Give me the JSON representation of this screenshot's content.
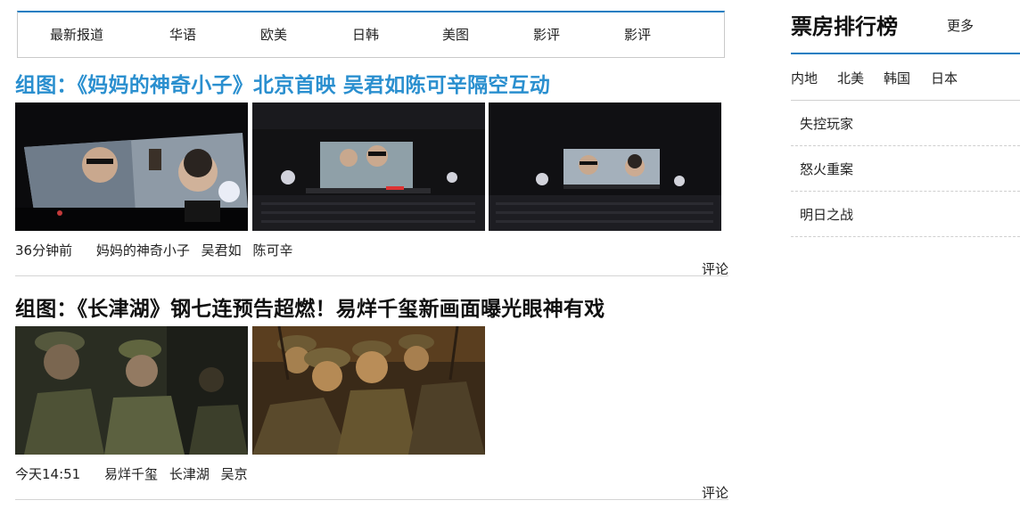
{
  "nav": {
    "tabs": [
      "最新报道",
      "华语",
      "欧美",
      "日韩",
      "美图",
      "影评",
      "影评"
    ],
    "accent_color": "#1b7ec2"
  },
  "articles": [
    {
      "title": "组图：《妈妈的神奇小子》北京首映 吴君如陈可辛隔空互动",
      "title_color": "#2a8fcf",
      "images": [
        "cinema-screen-photo",
        "cinema-hall-photo",
        "cinema-hall-wide-photo"
      ],
      "time": "36分钟前",
      "tags": [
        "妈妈的神奇小子",
        "吴君如",
        "陈可辛"
      ],
      "comment_label": "评论"
    },
    {
      "title": "组图：《长津湖》钢七连预告超燃！易烊千玺新画面曝光眼神有戏",
      "title_color": "#111111",
      "images": [
        "soldiers-still-photo",
        "soldiers-group-photo"
      ],
      "time": "今天14:51",
      "tags": [
        "易烊千玺",
        "长津湖",
        "吴京"
      ],
      "comment_label": "评论"
    }
  ],
  "sidebar": {
    "title": "票房排行榜",
    "more_label": "更多",
    "regions": [
      "内地",
      "北美",
      "韩国",
      "日本"
    ],
    "rankings": [
      "失控玩家",
      "怒火重案",
      "明日之战"
    ]
  }
}
